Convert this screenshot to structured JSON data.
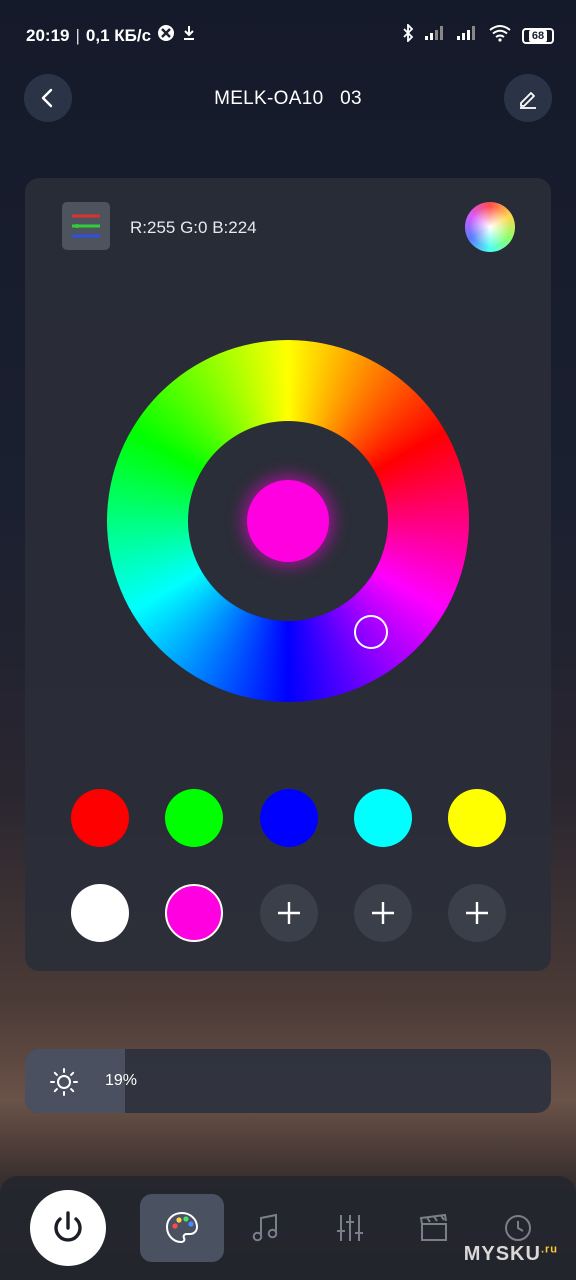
{
  "status_bar": {
    "time": "20:19",
    "speed": "0,1 КБ/с",
    "battery": "68",
    "icons": [
      "vpn-icon",
      "download-icon",
      "bluetooth-icon",
      "signal-icon",
      "signal-icon",
      "wifi-icon",
      "battery-icon"
    ]
  },
  "header": {
    "title": "MELK-OA10   03",
    "back_icon": "chevron-left-icon",
    "edit_icon": "edit-icon"
  },
  "color_card": {
    "rgb_readout": "R:255 G:0 B:224",
    "current_color": "#ff00e0",
    "mode_icon": "rgb-lines-icon",
    "spectrum_icon": "spectrum-icon"
  },
  "swatches": {
    "row1": [
      "#ff0000",
      "#00ff00",
      "#0000ff",
      "#00ffff",
      "#ffff00"
    ],
    "row2": [
      {
        "type": "color",
        "color": "#ffffff"
      },
      {
        "type": "color",
        "color": "#ff00e0",
        "selected": true
      },
      {
        "type": "add",
        "icon": "plus-icon"
      },
      {
        "type": "add",
        "icon": "plus-icon"
      },
      {
        "type": "add",
        "icon": "plus-icon"
      }
    ]
  },
  "brightness": {
    "label": "19%",
    "value": 0.19,
    "icon": "sun-icon"
  },
  "bottom_nav": {
    "items": [
      "power-icon",
      "palette-icon",
      "music-icon",
      "sliders-icon",
      "scene-icon",
      "clock-icon"
    ],
    "active": "palette-icon"
  },
  "watermark": {
    "text": "MYSKU",
    "suffix": ".ru"
  }
}
